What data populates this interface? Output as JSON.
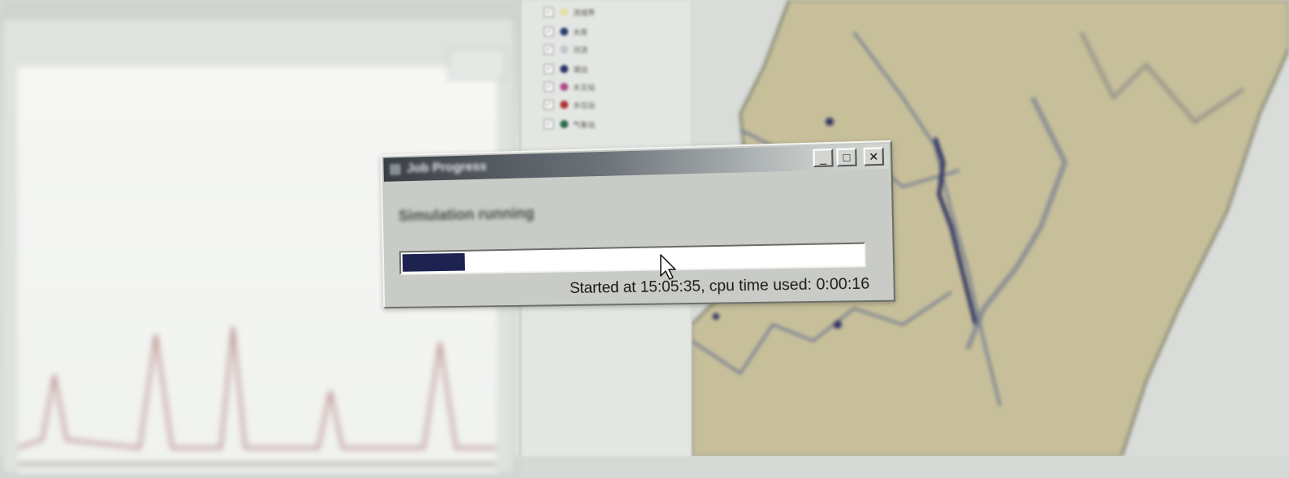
{
  "dialog": {
    "title": "Job Progress",
    "status_message": "Simulation running",
    "progress": 0.14,
    "elapsed_text": "Started at 15:05:35, cpu time used: 0:00:16",
    "buttons": {
      "minimize": "_",
      "maximize": "□",
      "close": "✕"
    }
  },
  "layers": {
    "items": [
      {
        "label": "流域界",
        "checked": true,
        "symbol_color": "#e8e0a0"
      },
      {
        "label": "水库",
        "checked": true,
        "symbol_color": "#2d3a70"
      },
      {
        "label": "河流",
        "checked": true,
        "symbol_color": "#c0c4cc"
      },
      {
        "label": "湖泊",
        "checked": true,
        "symbol_color": "#2a2f66"
      },
      {
        "label": "水文站",
        "checked": true,
        "symbol_color": "#b04a8a"
      },
      {
        "label": "水位站",
        "checked": true,
        "symbol_color": "#b03030"
      },
      {
        "label": "气象站",
        "checked": true,
        "symbol_color": "#2b6a4a"
      }
    ]
  },
  "colors": {
    "map_fill": "#c7bf9a",
    "map_line": "#707b92",
    "river": "#2b2f60",
    "progress_fill": "#1e2250"
  },
  "icons": {
    "cursor": "arrow-cursor-icon"
  }
}
